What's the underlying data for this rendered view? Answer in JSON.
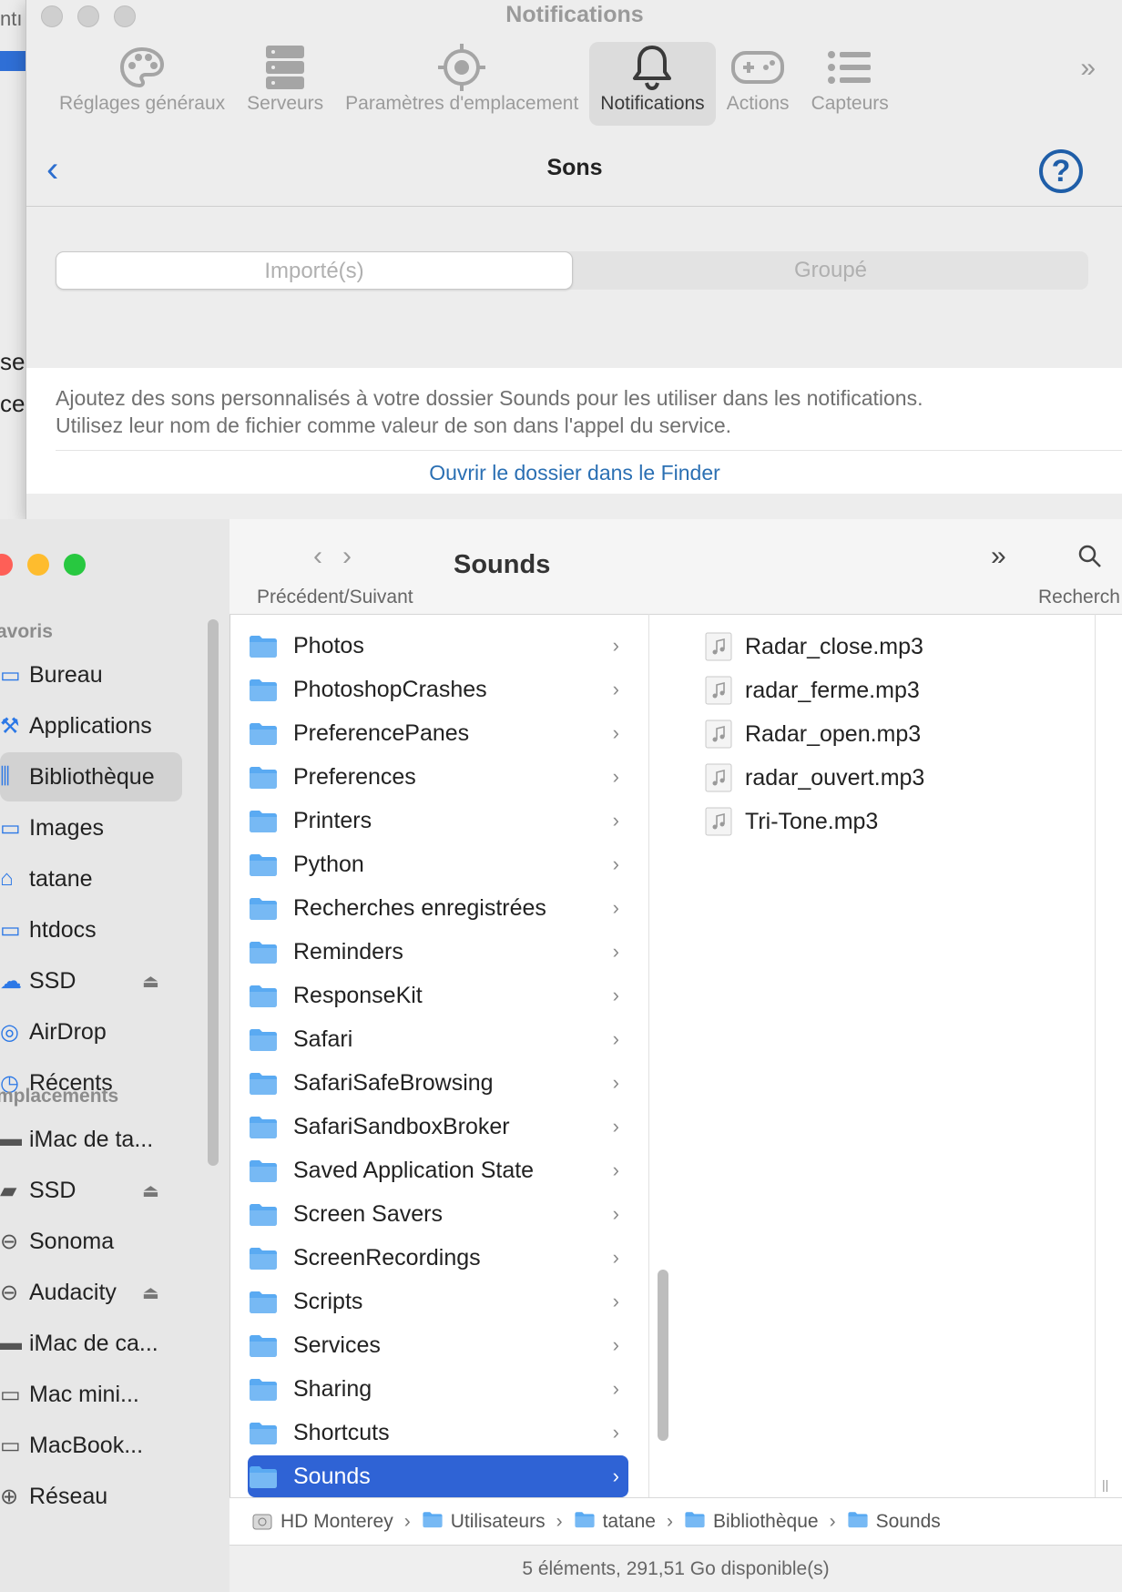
{
  "background_window": {
    "frag_top": "ntı",
    "frag_1": "se",
    "frag_2": "ce"
  },
  "prefs": {
    "title": "Notifications",
    "toolbar": [
      {
        "label": "Réglages généraux",
        "icon": "palette-icon"
      },
      {
        "label": "Serveurs",
        "icon": "server-icon"
      },
      {
        "label": "Paramètres d'emplacement",
        "icon": "location-target-icon"
      },
      {
        "label": "Notifications",
        "icon": "bell-icon",
        "active": true
      },
      {
        "label": "Actions",
        "icon": "gamepad-icon"
      },
      {
        "label": "Capteurs",
        "icon": "list-icon"
      }
    ],
    "more_glyph": "»",
    "nav": {
      "back": "‹",
      "title": "Sons",
      "help": "?"
    },
    "segments": [
      "Importé(s)",
      "Groupé"
    ],
    "info_text_1": "Ajoutez des sons personnalisés à votre dossier Sounds pour les utiliser dans les notifications.",
    "info_text_2": "Utilisez leur nom de fichier comme valeur de son dans l'appel du service.",
    "open_link": "Ouvrir le dossier dans le Finder"
  },
  "finder": {
    "title": "Sounds",
    "nav_label": "Précédent/Suivant",
    "search_label": "Recherch",
    "sidebar": {
      "favorites_header": "avoris",
      "favorites": [
        {
          "label": "Bureau",
          "icon": "desktop-icon"
        },
        {
          "label": "Applications",
          "icon": "applications-icon"
        },
        {
          "label": "Bibliothèque",
          "icon": "library-icon",
          "selected": true
        },
        {
          "label": "Images",
          "icon": "images-icon"
        },
        {
          "label": "tatane",
          "icon": "home-icon"
        },
        {
          "label": "htdocs",
          "icon": "folder-icon"
        },
        {
          "label": "SSD",
          "icon": "cloud-drive-icon",
          "eject": true
        },
        {
          "label": "AirDrop",
          "icon": "airdrop-icon"
        },
        {
          "label": "Récents",
          "icon": "clock-icon"
        }
      ],
      "locations_header": "mplacements",
      "locations": [
        {
          "label": "iMac de ta...",
          "icon": "imac-icon"
        },
        {
          "label": "SSD",
          "icon": "drive-icon",
          "eject": true
        },
        {
          "label": "Sonoma",
          "icon": "disk-icon"
        },
        {
          "label": "Audacity",
          "icon": "disk-icon",
          "eject": true
        },
        {
          "label": "iMac de ca...",
          "icon": "imac-icon"
        },
        {
          "label": "Mac mini...",
          "icon": "macmini-icon"
        },
        {
          "label": "MacBook...",
          "icon": "laptop-icon"
        },
        {
          "label": "Réseau",
          "icon": "network-icon"
        }
      ]
    },
    "folders": [
      "Photos",
      "PhotoshopCrashes",
      "PreferencePanes",
      "Preferences",
      "Printers",
      "Python",
      "Recherches enregistrées",
      "Reminders",
      "ResponseKit",
      "Safari",
      "SafariSafeBrowsing",
      "SafariSandboxBroker",
      "Saved Application State",
      "Screen Savers",
      "ScreenRecordings",
      "Scripts",
      "Services",
      "Sharing",
      "Shortcuts",
      "Sounds"
    ],
    "selected_folder": "Sounds",
    "files": [
      "Radar_close.mp3",
      "radar_ferme.mp3",
      "Radar_open.mp3",
      "radar_ouvert.mp3",
      "Tri-Tone.mp3"
    ],
    "path": [
      "HD Monterey",
      "Utilisateurs",
      "tatane",
      "Bibliothèque",
      "Sounds"
    ],
    "status": "5 éléments, 291,51 Go disponible(s)"
  },
  "colors": {
    "accent": "#2f63d5",
    "folder": "#5aaaf2",
    "link": "#2a6fb3",
    "help": "#1f5ea8"
  }
}
